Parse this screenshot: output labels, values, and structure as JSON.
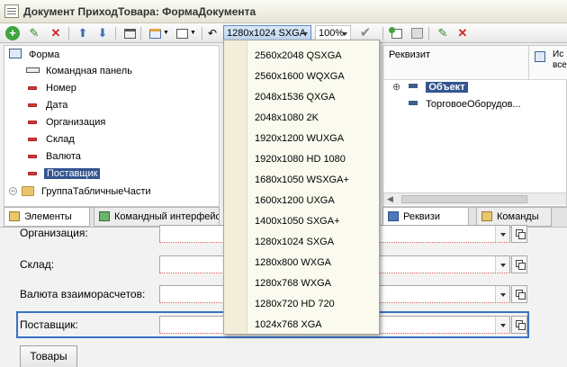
{
  "window": {
    "title": "Документ ПриходТовара: ФормаДокумента"
  },
  "toolbar": {
    "resolution_value": "1280x1024 SXGA",
    "zoom_value": "100%"
  },
  "resolution_menu": {
    "items": [
      "2560x2048 QSXGA",
      "2560x1600 WQXGA",
      "2048x1536 QXGA",
      "2048x1080 2K",
      "1920x1200 WUXGA",
      "1920x1080 HD 1080",
      "1680x1050 WSXGA+",
      "1600x1200 UXGA",
      "1400x1050 SXGA+",
      "1280x1024 SXGA",
      "1280x800 WXGA",
      "1280x768 WXGA",
      "1280x720 HD 720",
      "1024x768 XGA"
    ]
  },
  "elements_tree": {
    "root": "Форма",
    "items": [
      "Командная панель",
      "Номер",
      "Дата",
      "Организация",
      "Склад",
      "Валюта",
      "Поставщик"
    ],
    "selected": "Поставщик",
    "group": "ГруппаТабличныеЧасти"
  },
  "props_pane": {
    "header_col1": "Реквизит",
    "header_col2a": "Ис",
    "header_col2b": "все",
    "object": "Объект",
    "child": "ТорговоеОборудов..."
  },
  "tabs_left": [
    "Элементы",
    "Командный интерфейс"
  ],
  "tabs_right": [
    "Реквизи",
    "Команды"
  ],
  "form_preview": {
    "fields": [
      "Организация:",
      "Склад:",
      "Валюта взаиморасчетов:",
      "Поставщик:"
    ],
    "button": "Товары"
  },
  "colors": {
    "selection": "#33558f",
    "accent": "#5d8cc4"
  }
}
